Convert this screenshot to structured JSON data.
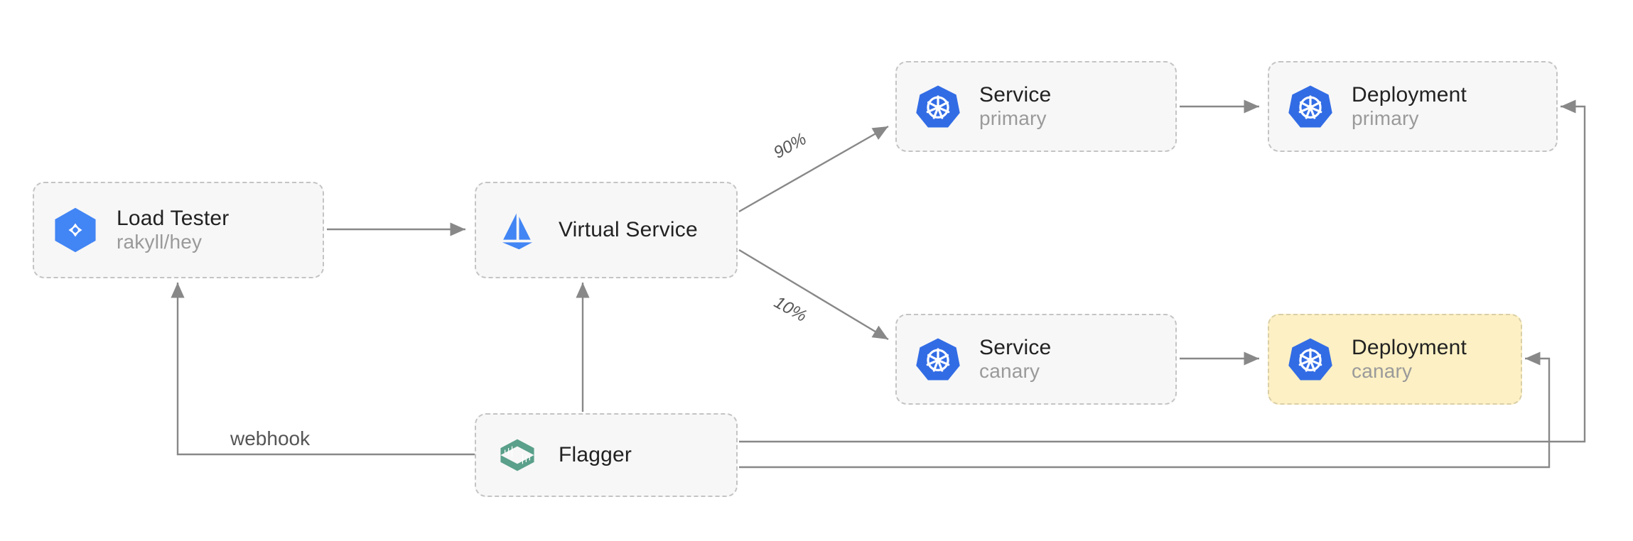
{
  "nodes": {
    "load_tester": {
      "title": "Load Tester",
      "sub": "rakyll/hey"
    },
    "virtual_service": {
      "title": "Virtual Service",
      "sub": ""
    },
    "flagger": {
      "title": "Flagger",
      "sub": ""
    },
    "service_primary": {
      "title": "Service",
      "sub": "primary"
    },
    "service_canary": {
      "title": "Service",
      "sub": "canary"
    },
    "deploy_primary": {
      "title": "Deployment",
      "sub": "primary"
    },
    "deploy_canary": {
      "title": "Deployment",
      "sub": "canary"
    }
  },
  "edges": {
    "webhook": "webhook",
    "pct_primary": "90%",
    "pct_canary": "10%"
  },
  "icons": {
    "load_tester": "gcp-hex-icon",
    "virtual_service": "istio-sailboat-icon",
    "flagger": "flagger-icon",
    "kubernetes": "kubernetes-helm-icon"
  },
  "colors": {
    "node_bg": "#f7f7f7",
    "node_border": "#c4c4c4",
    "highlight_bg": "#fdf0c4",
    "highlight_border": "#d9cfa7",
    "icon_blue": "#4285f4",
    "icon_teal": "#5aa08a",
    "arrow": "#888888",
    "text_primary": "#222222",
    "text_secondary": "#9a9a9a"
  },
  "diagram_type": "architecture-flow",
  "description": "Flagger canary deployment traffic-splitting topology with Istio VirtualService"
}
